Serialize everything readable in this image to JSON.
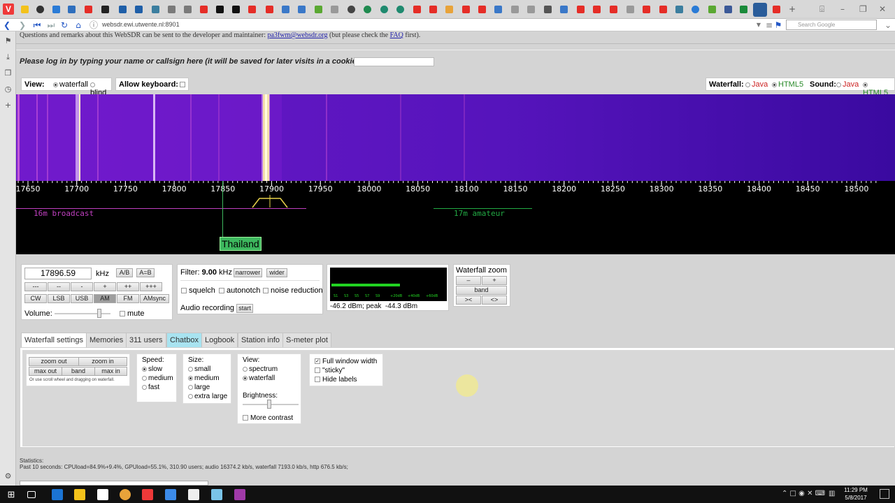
{
  "browser": {
    "url": "websdr.ewi.utwente.nl:8901",
    "search_placeholder": "Search Google"
  },
  "page": {
    "intro_before": "Questions and remarks about this WebSDR can be sent to the developer and maintainer: ",
    "intro_email": "pa3fwm@websdr.org",
    "intro_middle": " (but please check the ",
    "intro_faq": "FAQ",
    "intro_after": " first).",
    "login_prompt": "Please log in by typing your name or callsign here (it will be saved for later visits in a cookie):"
  },
  "view_bar": {
    "view_label": "View:",
    "view_waterfall": "waterfall",
    "view_blind": "blind",
    "keyboard_label": "Allow keyboard:",
    "waterfall_label": "Waterfall:",
    "waterfall_java": "Java",
    "waterfall_html5": "HTML5",
    "sound_label": "Sound:",
    "sound_java": "Java",
    "sound_html5": "HTML5"
  },
  "spectrum": {
    "ticks": [
      "17650",
      "17700",
      "17750",
      "17800",
      "17850",
      "17900",
      "17950",
      "18000",
      "18050",
      "18100",
      "18150",
      "18200",
      "18250",
      "18300",
      "18350",
      "18400",
      "18450",
      "18500"
    ],
    "band_16m": "16m broadcast",
    "band_17m": "17m amateur",
    "station_label": "Thailand"
  },
  "tuning": {
    "frequency": "17896.59",
    "unit": "kHz",
    "ab": "A/B",
    "a_eq_b": "A=B",
    "step_buttons": [
      "---",
      "--",
      "-",
      "+",
      "++",
      "+++"
    ],
    "modes": [
      "CW",
      "LSB",
      "USB",
      "AM",
      "FM",
      "AMsync"
    ],
    "active_mode": "AM",
    "volume_label": "Volume:",
    "mute_label": "mute"
  },
  "filter": {
    "label": "Filter:",
    "value": "9.00",
    "unit": "kHz",
    "narrower": "narrower",
    "wider": "wider",
    "squelch": "squelch",
    "autonotch": "autonotch",
    "noise_reduction": "noise reduction",
    "audio_recording": "Audio recording",
    "start": "start"
  },
  "smeter": {
    "readout": "-46.2 dBm; peak  -44.3 dBm",
    "level_fraction": 0.6
  },
  "waterfall_zoom": {
    "title": "Waterfall zoom",
    "minus": "–",
    "plus": "+",
    "band": "band",
    "left": "><",
    "right": "<>"
  },
  "tabs": [
    "Waterfall settings",
    "Memories",
    "311 users",
    "Chatbox",
    "Logbook",
    "Station info",
    "S-meter plot"
  ],
  "settings": {
    "zoom_out": "zoom out",
    "zoom_in": "zoom in",
    "max_out": "max out",
    "band": "band",
    "max_in": "max in",
    "hint": "Or use scroll wheel and dragging on waterfall.",
    "speed_label": "Speed:",
    "speed_slow": "slow",
    "speed_medium": "medium",
    "speed_fast": "fast",
    "size_label": "Size:",
    "size_small": "small",
    "size_medium": "medium",
    "size_large": "large",
    "size_xlarge": "extra large",
    "view_label": "View:",
    "view_spectrum": "spectrum",
    "view_waterfall": "waterfall",
    "brightness_label": "Brightness:",
    "more_contrast": "More contrast",
    "full_width": "Full window width",
    "sticky": "\"sticky\"",
    "hide_labels": "Hide labels"
  },
  "stats": {
    "title": "Statistics:",
    "line": "Past 10 seconds: CPUload=84.9%+9.4%, GPUload=55.1%, 310.90 users; audio 16374.2 kb/s, waterfall 7193.0 kb/s, http 676.5 kb/s;"
  },
  "taskbar": {
    "time": "11:29 PM",
    "date": "5/8/2017"
  },
  "colors": {
    "waterfall_bg": "#4b11b0",
    "band_16m": "#c040c0",
    "band_17m": "#22aa44",
    "station": "#3db85e",
    "chatbox_tab": "#a8e3f0"
  }
}
